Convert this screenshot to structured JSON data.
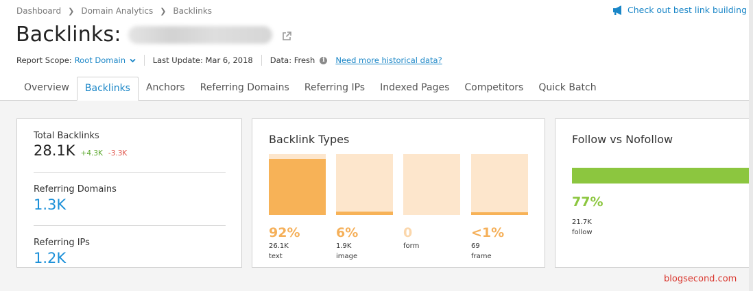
{
  "breadcrumb": [
    "Dashboard",
    "Domain Analytics",
    "Backlinks"
  ],
  "tips_link": "Check out best link building tips",
  "page_title": "Backlinks:",
  "meta": {
    "scope_label": "Report Scope:",
    "scope_value": "Root Domain",
    "last_update": "Last Update: Mar 6, 2018",
    "data_label": "Data: Fresh",
    "historical_link": "Need more historical data?"
  },
  "tabs": [
    "Overview",
    "Backlinks",
    "Anchors",
    "Referring Domains",
    "Referring IPs",
    "Indexed Pages",
    "Competitors",
    "Quick Batch"
  ],
  "summary": {
    "total_label": "Total Backlinks",
    "total_value": "28.1K",
    "total_up": "+4.3K",
    "total_down": "-3.3K",
    "domains_label": "Referring Domains",
    "domains_value": "1.3K",
    "ips_label": "Referring IPs",
    "ips_value": "1.2K"
  },
  "types": {
    "title": "Backlink Types",
    "items": [
      {
        "pct": "92%",
        "count": "26.1K",
        "label": "text",
        "fill": 0.92
      },
      {
        "pct": "6%",
        "count": "1.9K",
        "label": "image",
        "fill": 0.06
      },
      {
        "pct": "0",
        "count": "",
        "label": "form",
        "fill": 0
      },
      {
        "pct": "<1%",
        "count": "69",
        "label": "frame",
        "fill": 0.02
      }
    ]
  },
  "follow": {
    "title": "Follow vs Nofollow",
    "pct": "77%",
    "count": "21.7K",
    "label": "follow",
    "fill": 0.77
  },
  "watermark": "blogsecond.com",
  "colors": {
    "accent_blue": "#1a86c7",
    "orange": "#f7b257",
    "orange_light": "#fde6cc",
    "green": "#8cc63f",
    "red": "#d9342b"
  }
}
